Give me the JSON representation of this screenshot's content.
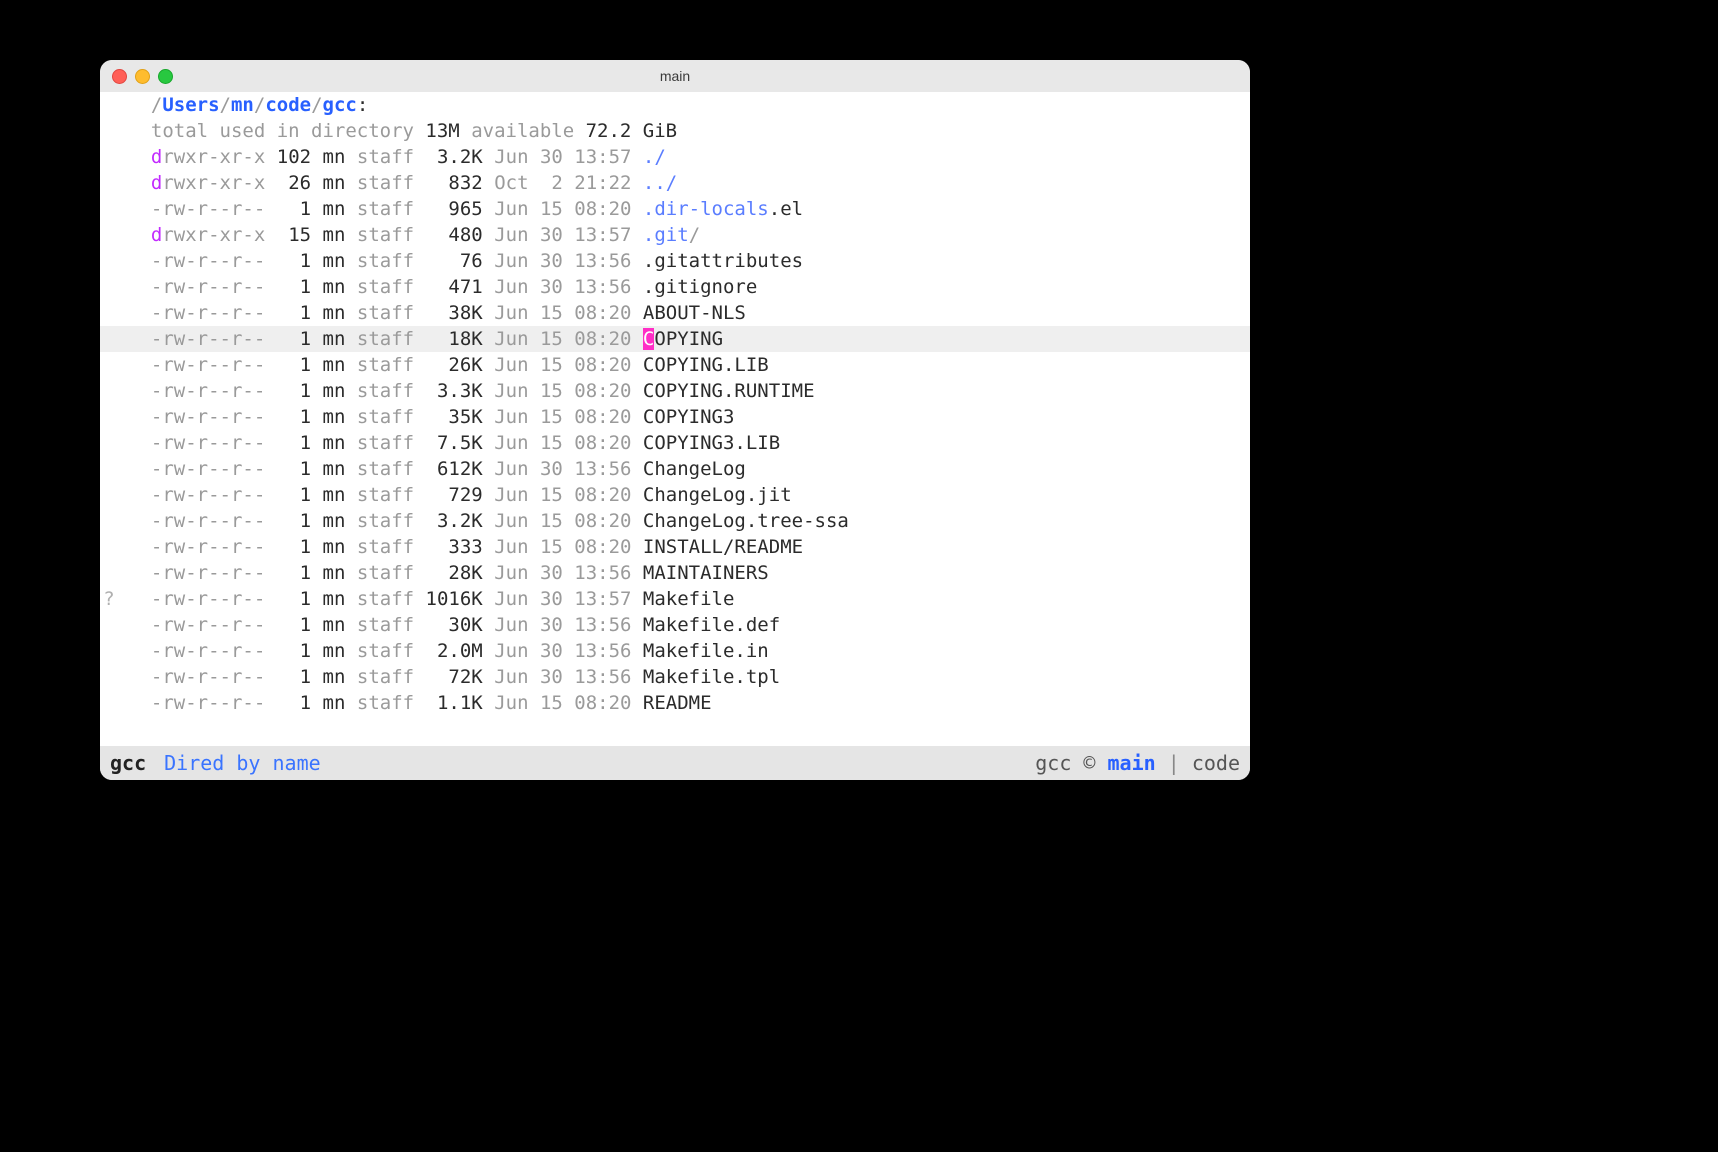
{
  "window": {
    "title": "main"
  },
  "path": {
    "lead": "/",
    "segments": [
      "Users",
      "mn",
      "code",
      "gcc"
    ],
    "sep": "/",
    "trail": ":"
  },
  "summary": {
    "prefix": "total used in directory ",
    "used": "13M",
    "avail_label": " available ",
    "avail": "72.2 GiB"
  },
  "entries": [
    {
      "perm_d": "d",
      "perm": "rwxr-xr-x",
      "links": "102",
      "user": "mn",
      "group": "staff",
      "size": "3.2K",
      "date": "Jun 30 13:57",
      "name_pre": "",
      "name": "./",
      "name_post": "",
      "style": "blue2",
      "hl": false
    },
    {
      "perm_d": "d",
      "perm": "rwxr-xr-x",
      "links": " 26",
      "user": "mn",
      "group": "staff",
      "size": " 832",
      "date": "Oct  2 21:22",
      "name_pre": "",
      "name": "../",
      "name_post": "",
      "style": "blue2",
      "hl": false
    },
    {
      "perm_d": "-",
      "perm": "rw-r--r--",
      "links": "  1",
      "user": "mn",
      "group": "staff",
      "size": " 965",
      "date": "Jun 15 08:20",
      "name_pre": "",
      "name": ".dir-locals",
      "name_post": ".el",
      "style": "blue2",
      "hl": false
    },
    {
      "perm_d": "d",
      "perm": "rwxr-xr-x",
      "links": " 15",
      "user": "mn",
      "group": "staff",
      "size": " 480",
      "date": "Jun 30 13:57",
      "name_pre": "",
      "name": ".git",
      "name_post": "/",
      "style": "blue2",
      "hl": false
    },
    {
      "perm_d": "-",
      "perm": "rw-r--r--",
      "links": "  1",
      "user": "mn",
      "group": "staff",
      "size": "  76",
      "date": "Jun 30 13:56",
      "name_pre": "",
      "name": ".gitattributes",
      "name_post": "",
      "style": "fg",
      "hl": false
    },
    {
      "perm_d": "-",
      "perm": "rw-r--r--",
      "links": "  1",
      "user": "mn",
      "group": "staff",
      "size": " 471",
      "date": "Jun 30 13:56",
      "name_pre": "",
      "name": ".gitignore",
      "name_post": "",
      "style": "fg",
      "hl": false
    },
    {
      "perm_d": "-",
      "perm": "rw-r--r--",
      "links": "  1",
      "user": "mn",
      "group": "staff",
      "size": " 38K",
      "date": "Jun 15 08:20",
      "name_pre": "",
      "name": "ABOUT-NLS",
      "name_post": "",
      "style": "fg",
      "hl": false
    },
    {
      "perm_d": "-",
      "perm": "rw-r--r--",
      "links": "  1",
      "user": "mn",
      "group": "staff",
      "size": " 18K",
      "date": "Jun 15 08:20",
      "name_pre": "C",
      "name": "OPYING",
      "name_post": "",
      "style": "fg",
      "hl": true
    },
    {
      "perm_d": "-",
      "perm": "rw-r--r--",
      "links": "  1",
      "user": "mn",
      "group": "staff",
      "size": " 26K",
      "date": "Jun 15 08:20",
      "name_pre": "",
      "name": "COPYING.LIB",
      "name_post": "",
      "style": "fg",
      "hl": false
    },
    {
      "perm_d": "-",
      "perm": "rw-r--r--",
      "links": "  1",
      "user": "mn",
      "group": "staff",
      "size": "3.3K",
      "date": "Jun 15 08:20",
      "name_pre": "",
      "name": "COPYING.RUNTIME",
      "name_post": "",
      "style": "fg",
      "hl": false
    },
    {
      "perm_d": "-",
      "perm": "rw-r--r--",
      "links": "  1",
      "user": "mn",
      "group": "staff",
      "size": " 35K",
      "date": "Jun 15 08:20",
      "name_pre": "",
      "name": "COPYING3",
      "name_post": "",
      "style": "fg",
      "hl": false
    },
    {
      "perm_d": "-",
      "perm": "rw-r--r--",
      "links": "  1",
      "user": "mn",
      "group": "staff",
      "size": "7.5K",
      "date": "Jun 15 08:20",
      "name_pre": "",
      "name": "COPYING3.LIB",
      "name_post": "",
      "style": "fg",
      "hl": false
    },
    {
      "perm_d": "-",
      "perm": "rw-r--r--",
      "links": "  1",
      "user": "mn",
      "group": "staff",
      "size": "612K",
      "date": "Jun 30 13:56",
      "name_pre": "",
      "name": "ChangeLog",
      "name_post": "",
      "style": "fg",
      "hl": false
    },
    {
      "perm_d": "-",
      "perm": "rw-r--r--",
      "links": "  1",
      "user": "mn",
      "group": "staff",
      "size": " 729",
      "date": "Jun 15 08:20",
      "name_pre": "",
      "name": "ChangeLog.jit",
      "name_post": "",
      "style": "fg",
      "hl": false
    },
    {
      "perm_d": "-",
      "perm": "rw-r--r--",
      "links": "  1",
      "user": "mn",
      "group": "staff",
      "size": "3.2K",
      "date": "Jun 15 08:20",
      "name_pre": "",
      "name": "ChangeLog.tree-ssa",
      "name_post": "",
      "style": "fg",
      "hl": false
    },
    {
      "perm_d": "-",
      "perm": "rw-r--r--",
      "links": "  1",
      "user": "mn",
      "group": "staff",
      "size": " 333",
      "date": "Jun 15 08:20",
      "name_pre": "",
      "name": "INSTALL/README",
      "name_post": "",
      "style": "fg",
      "hl": false
    },
    {
      "perm_d": "-",
      "perm": "rw-r--r--",
      "links": "  1",
      "user": "mn",
      "group": "staff",
      "size": " 28K",
      "date": "Jun 30 13:56",
      "name_pre": "",
      "name": "MAINTAINERS",
      "name_post": "",
      "style": "fg",
      "hl": false
    },
    {
      "perm_d": "-",
      "perm": "rw-r--r--",
      "links": "  1",
      "user": "mn",
      "group": "staff",
      "size": "1016K",
      "date": "Jun 30 13:57",
      "name_pre": "",
      "name": "Makefile",
      "name_post": "",
      "style": "fg",
      "hl": false,
      "gutter": "?"
    },
    {
      "perm_d": "-",
      "perm": "rw-r--r--",
      "links": "  1",
      "user": "mn",
      "group": "staff",
      "size": " 30K",
      "date": "Jun 30 13:56",
      "name_pre": "",
      "name": "Makefile.def",
      "name_post": "",
      "style": "fg",
      "hl": false
    },
    {
      "perm_d": "-",
      "perm": "rw-r--r--",
      "links": "  1",
      "user": "mn",
      "group": "staff",
      "size": "2.0M",
      "date": "Jun 30 13:56",
      "name_pre": "",
      "name": "Makefile.in",
      "name_post": "",
      "style": "fg",
      "hl": false
    },
    {
      "perm_d": "-",
      "perm": "rw-r--r--",
      "links": "  1",
      "user": "mn",
      "group": "staff",
      "size": " 72K",
      "date": "Jun 30 13:56",
      "name_pre": "",
      "name": "Makefile.tpl",
      "name_post": "",
      "style": "fg",
      "hl": false
    },
    {
      "perm_d": "-",
      "perm": "rw-r--r--",
      "links": "  1",
      "user": "mn",
      "group": "staff",
      "size": "1.1K",
      "date": "Jun 15 08:20",
      "name_pre": "",
      "name": "README",
      "name_post": "",
      "style": "fg",
      "hl": false
    }
  ],
  "modeline": {
    "buffer": "gcc",
    "mode": "Dired by name",
    "right_project": "gcc",
    "vc_symbol": "©",
    "branch": "main",
    "sep": "|",
    "context": "code"
  }
}
